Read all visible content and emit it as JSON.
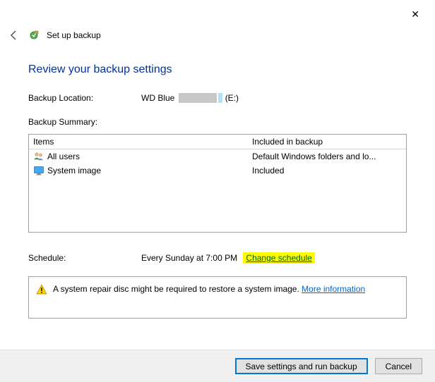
{
  "window": {
    "title": "Set up backup"
  },
  "page": {
    "heading": "Review your backup settings",
    "location_label": "Backup Location:",
    "location_prefix": "WD Blue",
    "location_drive": "(E:)",
    "summary_label": "Backup Summary:",
    "col_items": "Items",
    "col_included": "Included in backup",
    "rows": [
      {
        "item": "All users",
        "included": "Default Windows folders and lo..."
      },
      {
        "item": "System image",
        "included": "Included"
      }
    ],
    "schedule_label": "Schedule:",
    "schedule_value": "Every Sunday at 7:00 PM",
    "change_schedule": "Change schedule",
    "notice_text": "A system repair disc might be required to restore a system image.",
    "more_info": "More information"
  },
  "buttons": {
    "save": "Save settings and run backup",
    "cancel": "Cancel"
  }
}
